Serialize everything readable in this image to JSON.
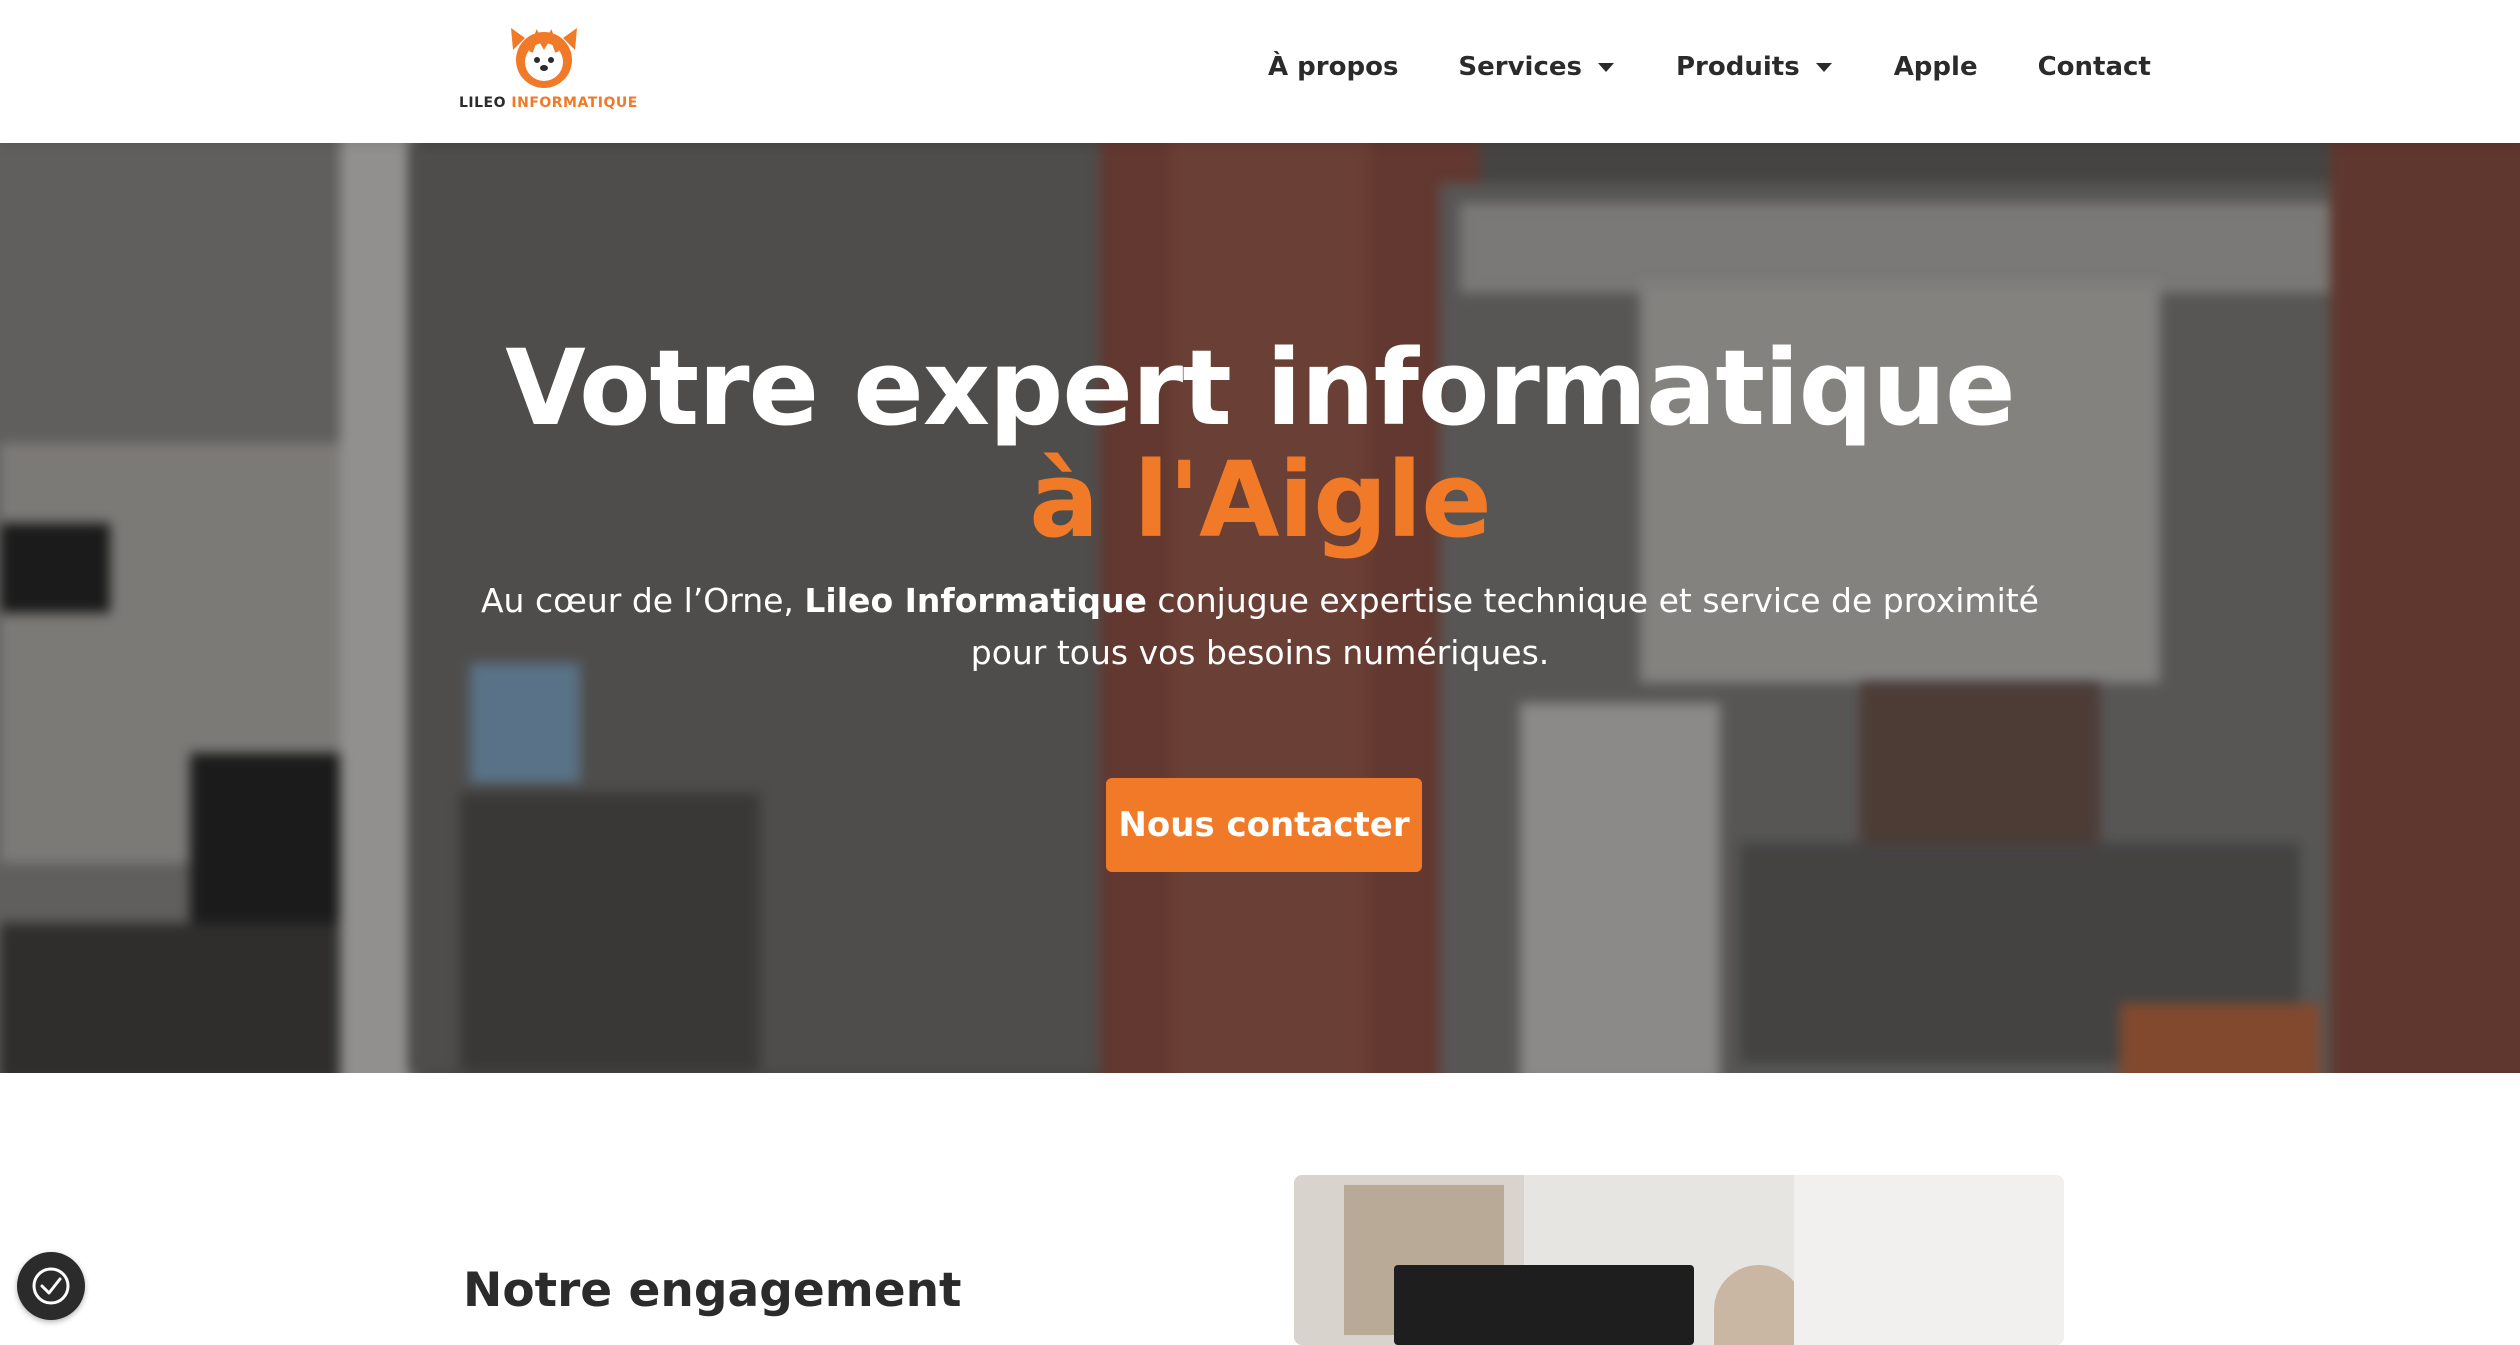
{
  "brand": {
    "logo_text_part1": "LILEO",
    "logo_text_part2": "INFORMATIQUE",
    "accent_color": "#f07a28",
    "text_color": "#2b2b2b"
  },
  "nav": {
    "items": [
      {
        "label": "À propos",
        "has_dropdown": false
      },
      {
        "label": "Services",
        "has_dropdown": true
      },
      {
        "label": "Produits",
        "has_dropdown": true
      },
      {
        "label": "Apple",
        "has_dropdown": false
      },
      {
        "label": "Contact",
        "has_dropdown": false
      }
    ]
  },
  "hero": {
    "title_line1": "Votre expert informatique",
    "title_line2": "à l'Aigle",
    "subtitle_before": "Au cœur de l’Orne, ",
    "subtitle_bold": "Lileo Informatique",
    "subtitle_after": " conjugue expertise technique et service de proximité pour tous vos besoins numériques.",
    "cta_label": "Nous contacter"
  },
  "section": {
    "title": "Notre engagement"
  },
  "icons": {
    "cookie": "cookie-consent-icon",
    "caret": "chevron-down-icon"
  }
}
